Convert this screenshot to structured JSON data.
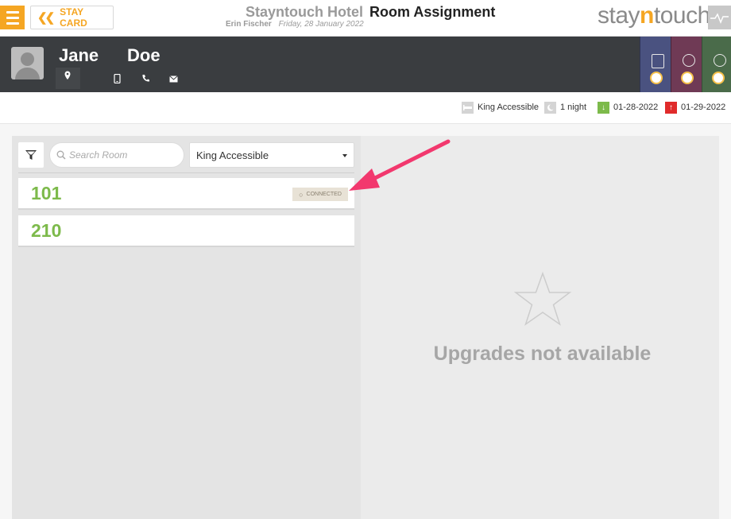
{
  "header": {
    "stay_card_label": "STAY CARD",
    "hotel_name": "Stayntouch Hotel",
    "page_title": "Room Assignment",
    "user_name": "Erin Fischer",
    "date": "Friday, 28 January 2022",
    "brand_part1": "stay",
    "brand_part2": "n",
    "brand_part3": "touch"
  },
  "guest": {
    "first_name": "Jane",
    "last_name": "Doe"
  },
  "reservation": {
    "room_type": "King Accessible",
    "nights": "1 night",
    "arrival": "01-28-2022",
    "departure": "01-29-2022"
  },
  "filters": {
    "search_placeholder": "Search Room",
    "room_type_selected": "King Accessible"
  },
  "rooms": [
    {
      "number": "101",
      "badge": "CONNECTED"
    },
    {
      "number": "210"
    }
  ],
  "upgrades": {
    "message": "Upgrades not available"
  },
  "colors": {
    "accent": "#f5a623",
    "room_number": "#7dba4b",
    "arrival": "#7dba4b",
    "departure": "#e02b2b",
    "annotation_arrow": "#f2386e",
    "tab1": "#4a5280",
    "tab2": "#6f3a55",
    "tab3": "#4a6b4a"
  }
}
